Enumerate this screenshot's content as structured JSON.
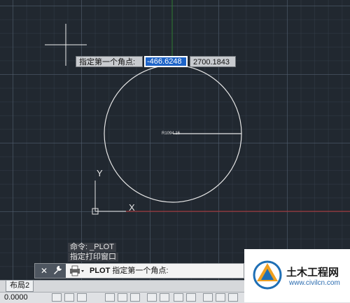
{
  "tooltip": {
    "prompt_label": "指定第一个角点:",
    "x_value": "-466.6248",
    "y_value": "2700.1843"
  },
  "drawing": {
    "radius_label": "R1094.16",
    "ucs_x_label": "X",
    "ucs_y_label": "Y"
  },
  "command": {
    "history": [
      "命令: _PLOT",
      "指定打印窗口"
    ],
    "current_cmd": "PLOT",
    "current_prompt": "指定第一个角点:",
    "close_icon": "close-icon",
    "settings_icon": "wrench-icon",
    "print_icon": "printer-icon"
  },
  "tabs": {
    "layout_tab": "布局2"
  },
  "status": {
    "coords": "0.0000"
  },
  "watermark": {
    "title": "土木工程网",
    "url": "www.civilcn.com"
  },
  "colors": {
    "canvas_bg": "#212830",
    "selection": "#1e64c8",
    "axis_green": "#2e7d32",
    "axis_red": "#b23030"
  }
}
